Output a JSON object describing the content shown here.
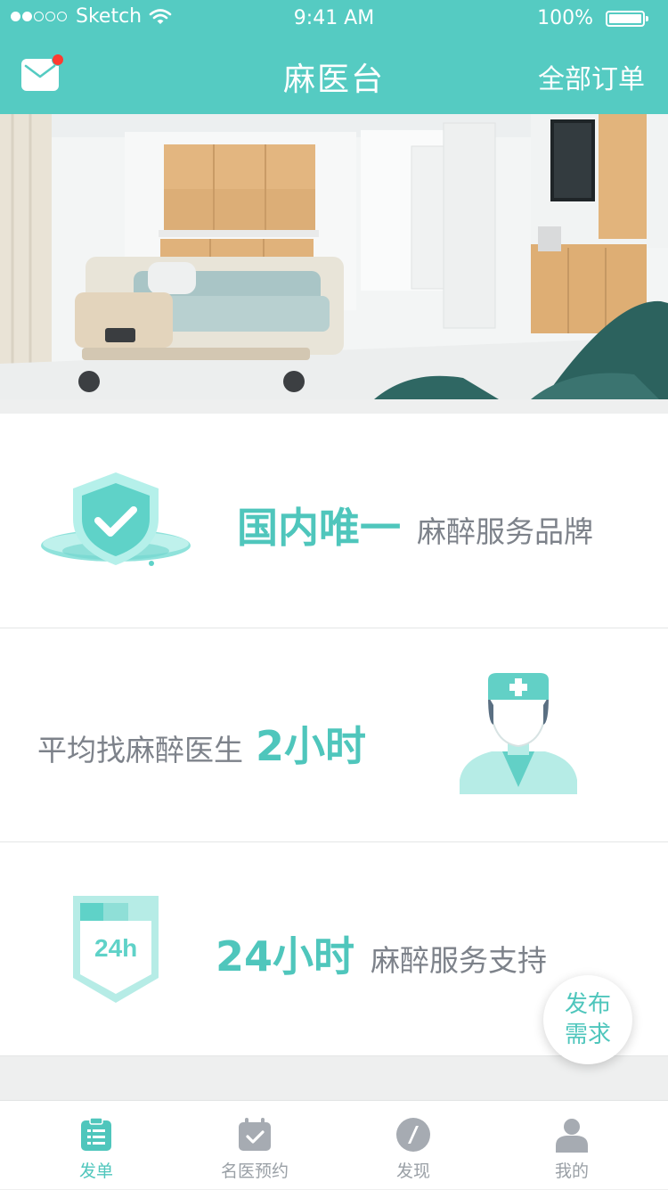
{
  "status_bar": {
    "carrier": "Sketch",
    "time": "9:41 AM",
    "battery": "100%"
  },
  "nav": {
    "title": "麻医台",
    "all_orders": "全部订单",
    "has_unread_mail": true
  },
  "features": [
    {
      "highlight": "国内唯一",
      "text": "麻醉服务品牌",
      "icon": "shield-check-icon"
    },
    {
      "text": "平均找麻醉医生",
      "highlight": "2小时",
      "icon": "doctor-icon"
    },
    {
      "highlight": "24小时",
      "text": "麻醉服务支持",
      "icon": "24h-badge-icon",
      "badge_text": "24h"
    }
  ],
  "fab": {
    "line1": "发布",
    "line2": "需求"
  },
  "tabs": [
    {
      "label": "发单",
      "icon": "clipboard-icon",
      "active": true
    },
    {
      "label": "名医预约",
      "icon": "calendar-check-icon",
      "active": false
    },
    {
      "label": "发现",
      "icon": "compass-icon",
      "active": false
    },
    {
      "label": "我的",
      "icon": "person-icon",
      "active": false
    }
  ],
  "colors": {
    "brand": "#55cbc2",
    "highlight": "#4fc6bc",
    "secondary_text": "#7d828a",
    "tab_inactive": "#9aa0a6",
    "badge": "#ff3b30"
  }
}
